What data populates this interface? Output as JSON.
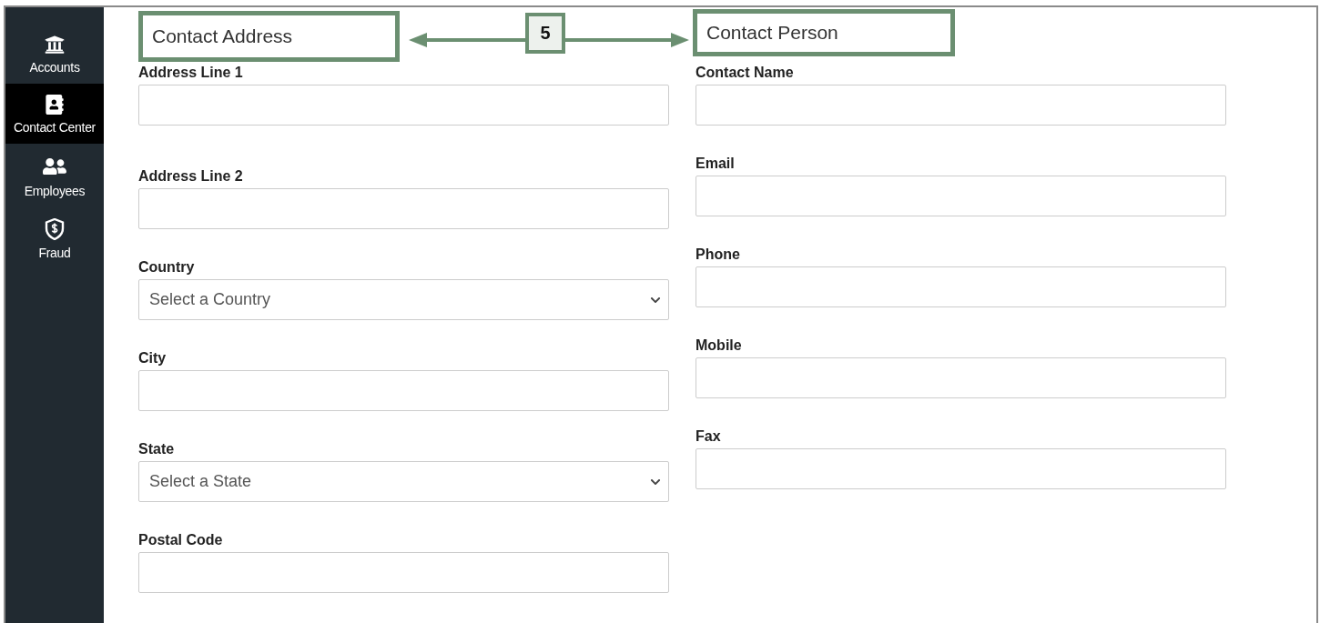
{
  "sidebar": {
    "items": [
      {
        "label": "Accounts",
        "kind": "bank",
        "selected": false
      },
      {
        "label": "Contact Center",
        "kind": "contact",
        "selected": true
      },
      {
        "label": "Employees",
        "kind": "people",
        "selected": false
      },
      {
        "label": "Fraud",
        "kind": "shield",
        "selected": false
      }
    ]
  },
  "callout": {
    "left": "Contact Address",
    "badge": "5",
    "right": "Contact Person"
  },
  "columns": [
    {
      "fields": [
        {
          "label": "Address Line 1",
          "kind": "text"
        },
        {
          "label": "Address Line 2",
          "kind": "text"
        },
        {
          "label": "Country",
          "kind": "select",
          "placeholder": "Select a Country"
        },
        {
          "label": "City",
          "kind": "text"
        },
        {
          "label": "State",
          "kind": "select",
          "placeholder": "Select a State"
        },
        {
          "label": "Postal Code",
          "kind": "text"
        }
      ]
    },
    {
      "fields": [
        {
          "label": "Contact Name",
          "kind": "text"
        },
        {
          "label": "Email",
          "kind": "text"
        },
        {
          "label": "Phone",
          "kind": "text"
        },
        {
          "label": "Mobile",
          "kind": "text"
        },
        {
          "label": "Fax",
          "kind": "text"
        }
      ]
    }
  ]
}
